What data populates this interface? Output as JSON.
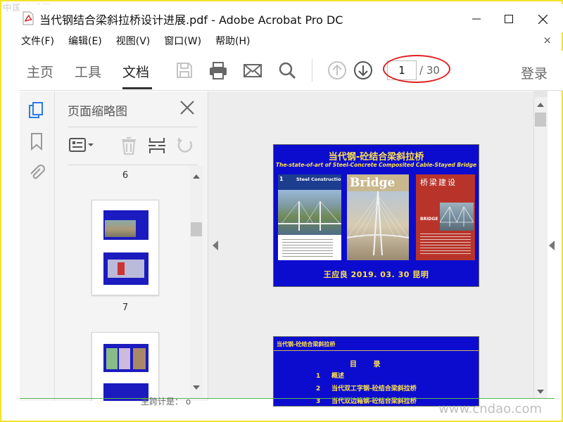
{
  "watermarks": {
    "top_left": "中国道桥网",
    "bottom_right": "www.cndao.com"
  },
  "titlebar": {
    "title": "当代钢结合梁斜拉桥设计进展.pdf - Adobe Acrobat Pro DC",
    "app_icon": "acrobat-pdf-icon"
  },
  "menubar": {
    "items": [
      "文件(F)",
      "编辑(E)",
      "视图(V)",
      "窗口(W)",
      "帮助(H)"
    ],
    "close_symbol": "×"
  },
  "toolbar": {
    "tabs": [
      {
        "label": "主页"
      },
      {
        "label": "工具"
      },
      {
        "label": "文档",
        "active": true
      }
    ],
    "icons": [
      "save-icon",
      "print-icon",
      "email-icon",
      "search-icon",
      "page-up-icon",
      "page-down-icon"
    ],
    "current_page": "1",
    "total_pages": "/ 30",
    "login": "登录",
    "accent_color": "#e02020"
  },
  "rail": {
    "icons": [
      "page-thumbnails-icon",
      "bookmark-icon",
      "attachment-icon"
    ]
  },
  "thumbnail_panel": {
    "title": "页面缩略图",
    "tool_icons": [
      "thumbnail-options-icon",
      "delete-page-icon",
      "insert-page-icon",
      "rotate-page-icon"
    ],
    "pages": [
      "6",
      "7"
    ]
  },
  "slide1": {
    "title": "当代钢-砼结合梁斜拉桥",
    "subtitle": "The-state-of-art  of  Steel-Concrete Composited Cable-Stayed Bridge",
    "author_line": "王应良   2019. 03. 30   昆明",
    "covers": [
      {
        "name": "Steel Construction",
        "tag": "1"
      },
      {
        "name": "Bridge"
      },
      {
        "name": "桥梁建设",
        "tag": "BRIDGE"
      }
    ],
    "bg_color": "#0c0ccf",
    "text_color": "#ffe24a"
  },
  "slide2": {
    "header": "当代钢-砼结合梁斜拉桥",
    "heading": "目  录",
    "items": [
      {
        "n": "1",
        "text": "概述"
      },
      {
        "n": "2",
        "text": "当代双工字钢-砼结合梁斜拉桥"
      },
      {
        "n": "3",
        "text": "当代双边箱钢-砼结合梁斜拉桥"
      }
    ]
  },
  "status": {
    "bottom_text": "主跨计是：  o"
  }
}
